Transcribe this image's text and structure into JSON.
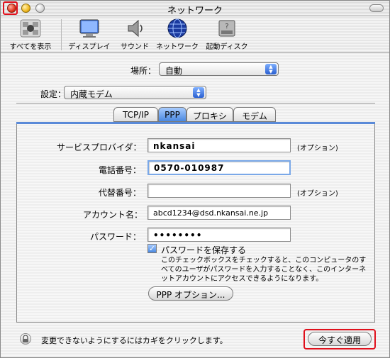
{
  "window": {
    "title": "ネットワーク"
  },
  "toolbar": {
    "items": [
      {
        "label": "すべてを表示",
        "icon": "apple-icon"
      },
      {
        "label": "ディスプレイ",
        "icon": "display-icon"
      },
      {
        "label": "サウンド",
        "icon": "speaker-icon"
      },
      {
        "label": "ネットワーク",
        "icon": "globe-icon"
      },
      {
        "label": "起動ディスク",
        "icon": "disk-icon"
      }
    ]
  },
  "location": {
    "label": "場所：",
    "value": "自動"
  },
  "show": {
    "label": "設定：",
    "value": "内蔵モデム"
  },
  "tabs": [
    {
      "label": "TCP/IP",
      "active": false
    },
    {
      "label": "PPP",
      "active": true
    },
    {
      "label": "プロキシ",
      "active": false
    },
    {
      "label": "モデム",
      "active": false
    }
  ],
  "form": {
    "provider": {
      "label": "サービスプロバイダ：",
      "value": "nkansai",
      "optional": "(オプション)"
    },
    "phone": {
      "label": "電話番号：",
      "value": "0570-010987"
    },
    "alt_phone": {
      "label": "代替番号：",
      "value": "",
      "optional": "(オプション)"
    },
    "account": {
      "label": "アカウント名：",
      "value": "abcd1234@dsd.nkansai.ne.jp"
    },
    "password": {
      "label": "パスワード：",
      "value": "••••••••"
    },
    "save_password": {
      "label": "パスワードを保存する",
      "checked": true,
      "check_glyph": "✓"
    },
    "help_text": "このチェックボックスをチェックすると、このコンピュータのすべてのユーザがパスワードを入力することなく、このインターネットアカウントにアクセスできるようになります。",
    "ppp_options_button": "PPP オプション..."
  },
  "footer": {
    "lock_text": "変更できないようにするにはカギをクリックします。",
    "apply_button": "今すぐ適用"
  },
  "colors": {
    "accent": "#4a88e0",
    "highlight": "#e0101c"
  }
}
